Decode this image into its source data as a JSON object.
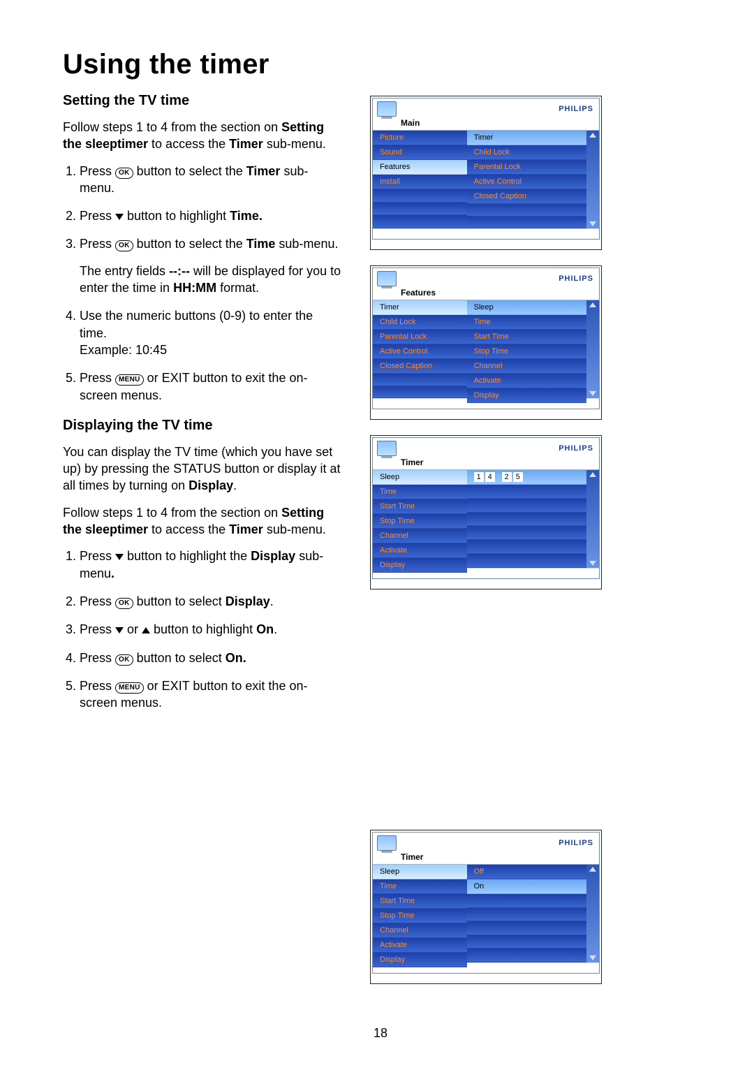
{
  "title": "Using the timer",
  "page_number": "18",
  "section1": {
    "heading": "Setting the TV time",
    "intro_pre": "Follow steps 1 to 4 from the section on ",
    "intro_bold1": "Setting the sleeptimer",
    "intro_mid": " to access the ",
    "intro_bold2": "Timer",
    "intro_post": " sub-menu.",
    "steps": {
      "s1_a": "Press ",
      "s1_b": " button to select the ",
      "s1_c": "Timer",
      "s1_d": " sub-menu.",
      "s2_a": "Press ",
      "s2_b": " button to highlight ",
      "s2_c": "Time.",
      "s3_a": "Press ",
      "s3_b": " button to select the ",
      "s3_c": "Time",
      "s3_d": " sub-menu.",
      "s3_note_a": "The entry fields ",
      "s3_note_b": "--:--",
      "s3_note_c": " will be displayed for you to enter the time in ",
      "s3_note_d": "HH:MM",
      "s3_note_e": " format.",
      "s4_a": "Use the numeric buttons (0-9) to enter the time.",
      "s4_b": "Example: 10:45",
      "s5_a": "Press ",
      "s5_b": " or EXIT button to exit the on-screen menus."
    }
  },
  "section2": {
    "heading": "Displaying the TV time",
    "p1_a": "You can display the TV time (which you have set up) by pressing the STATUS button or display it at all times by turning on ",
    "p1_b": "Display",
    "p1_c": ".",
    "intro_pre": "Follow steps 1 to 4 from the section on ",
    "intro_bold1": "Setting the sleeptimer",
    "intro_mid": " to access the ",
    "intro_bold2": "Timer",
    "intro_post": " sub-menu.",
    "steps": {
      "s1_a": "Press ",
      "s1_b": " button to highlight the ",
      "s1_c": "Display",
      "s1_d": " sub-menu",
      "s1_e": ".",
      "s2_a": "Press ",
      "s2_b": " button to select ",
      "s2_c": "Display",
      "s2_d": ".",
      "s3_a": "Press ",
      "s3_b": " or ",
      "s3_c": " button to highlight ",
      "s3_d": "On",
      "s3_e": ".",
      "s4_a": "Press ",
      "s4_b": " button to select ",
      "s4_c": "On.",
      "s5_a": "Press ",
      "s5_b": " or EXIT button to exit the on-screen menus."
    }
  },
  "buttons": {
    "ok": "OK",
    "menu": "MENU"
  },
  "osd": {
    "brand": "PHILIPS",
    "panel1": {
      "title": "Main",
      "left": [
        "Picture",
        "Sound",
        "Features",
        "Install"
      ],
      "left_selected": 2,
      "right": [
        "Timer",
        "Child Lock",
        "Parental Lock",
        "Active Control",
        "Closed Caption"
      ],
      "right_selected": 0
    },
    "panel2": {
      "title": "Features",
      "left": [
        "Timer",
        "Child Lock",
        "Parental Lock",
        "Active Control",
        "Closed Caption"
      ],
      "left_selected": 0,
      "right": [
        "Sleep",
        "Time",
        "Start Time",
        "Stop Time",
        "Channel",
        "Activate",
        "Display"
      ],
      "right_selected": 0
    },
    "panel3": {
      "title": "Timer",
      "left": [
        "Sleep",
        "Time",
        "Start Time",
        "Stop Time",
        "Channel",
        "Activate",
        "Display"
      ],
      "left_selected": 0,
      "right_value": [
        "1",
        "4",
        "2",
        "5"
      ]
    },
    "panel4": {
      "title": "Timer",
      "left": [
        "Sleep",
        "Time",
        "Start Time",
        "Stop Time",
        "Channel",
        "Activate",
        "Display"
      ],
      "left_selected": 0,
      "right": [
        "Off",
        "On"
      ],
      "right_selected": 1
    }
  }
}
